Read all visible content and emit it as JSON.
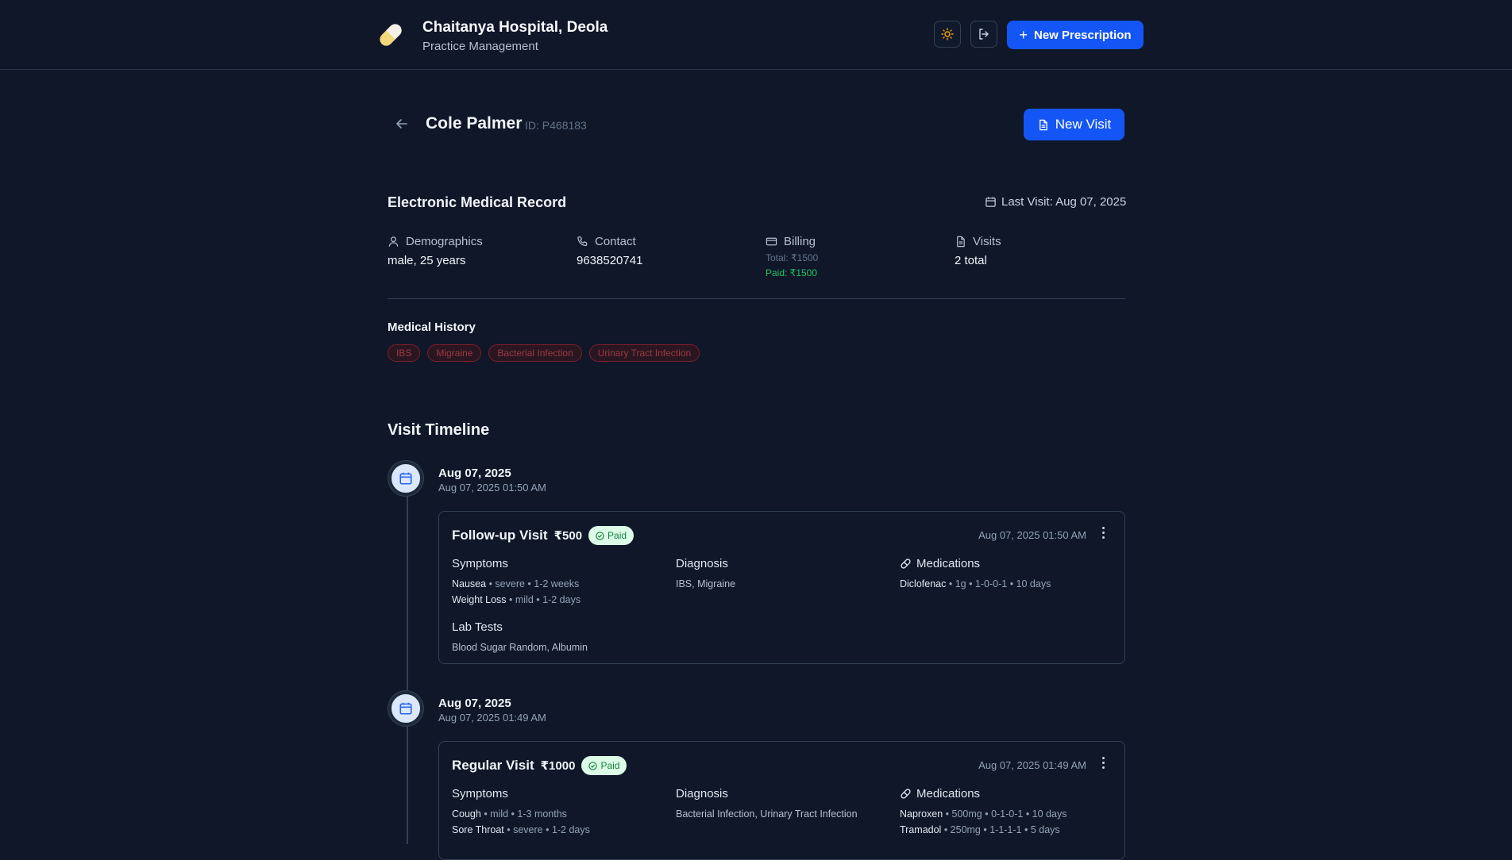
{
  "header": {
    "title": "Chaitanya Hospital, Deola",
    "subtitle": "Practice Management",
    "new_prescription": "New Prescription",
    "theme_icon": "sun-icon",
    "logout_icon": "logout-icon"
  },
  "patient": {
    "name": "Cole Palmer",
    "id": "ID: P468183",
    "new_visit": "New Visit"
  },
  "emr": {
    "title": "Electronic Medical Record",
    "last_visit": "Last Visit: Aug 07, 2025",
    "demographics_label": "Demographics",
    "demographics_value": "male, 25 years",
    "contact_label": "Contact",
    "contact_value": "9638520741",
    "billing_label": "Billing",
    "billing_total": "Total: ₹1500",
    "billing_paid": "Paid: ₹1500",
    "visits_label": "Visits",
    "visits_value": "2 total"
  },
  "medical_history": {
    "title": "Medical History",
    "tags": [
      "IBS",
      "Migraine",
      "Bacterial Infection",
      "Urinary Tract Infection"
    ]
  },
  "timeline": {
    "title": "Visit Timeline",
    "visits": [
      {
        "date": "Aug 07, 2025",
        "time": "Aug 07, 2025 01:50 AM",
        "type": "Follow-up Visit",
        "fee": "₹500",
        "status": "Paid",
        "timestamp": "Aug 07, 2025 01:50 AM",
        "symptoms_label": "Symptoms",
        "symptoms": [
          {
            "name": "Nausea",
            "detail": " • severe • 1-2 weeks"
          },
          {
            "name": "Weight Loss",
            "detail": " • mild • 1-2 days"
          }
        ],
        "diagnosis_label": "Diagnosis",
        "diagnosis": "IBS, Migraine",
        "medications_label": "Medications",
        "medications": [
          {
            "name": "Diclofenac",
            "detail": " • 1g • 1-0-0-1 • 10 days"
          }
        ],
        "lab_label": "Lab Tests",
        "lab_tests": "Blood Sugar Random, Albumin"
      },
      {
        "date": "Aug 07, 2025",
        "time": "Aug 07, 2025 01:49 AM",
        "type": "Regular Visit",
        "fee": "₹1000",
        "status": "Paid",
        "timestamp": "Aug 07, 2025 01:49 AM",
        "symptoms_label": "Symptoms",
        "symptoms": [
          {
            "name": "Cough",
            "detail": " • mild • 1-3 months"
          },
          {
            "name": "Sore Throat",
            "detail": " • severe • 1-2 days"
          }
        ],
        "diagnosis_label": "Diagnosis",
        "diagnosis": "Bacterial Infection, Urinary Tract Infection",
        "medications_label": "Medications",
        "medications": [
          {
            "name": "Naproxen",
            "detail": " • 500mg • 0-1-0-1 • 10 days"
          },
          {
            "name": "Tramadol",
            "detail": " • 250mg • 1-1-1-1 • 5 days"
          }
        ]
      }
    ]
  },
  "colors": {
    "background": "#0f1729",
    "primary": "#1456f5",
    "paid_green": "#22c55e",
    "tag_red": "#9b3a46"
  }
}
